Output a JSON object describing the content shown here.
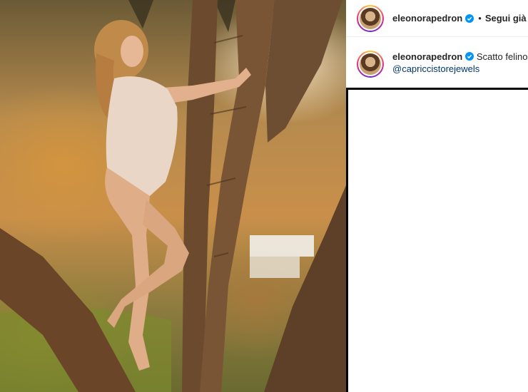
{
  "post": {
    "username": "eleonorapedron",
    "verified_icon": "verified-badge-icon",
    "separator": "•",
    "follow_label": "Segui già",
    "caption_author": "eleonorapedron",
    "caption_text": "Scatto felino",
    "caption_mention": "@capriccistorejewels"
  },
  "colors": {
    "verified_blue": "#0095f6",
    "mention_blue": "#00376b",
    "text": "#262626"
  }
}
